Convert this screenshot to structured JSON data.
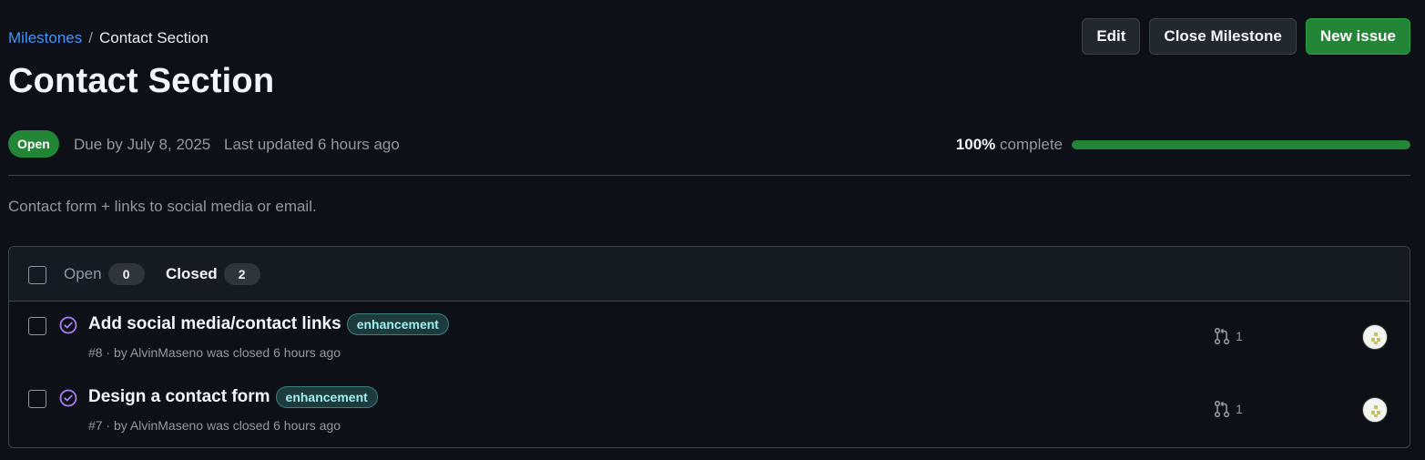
{
  "breadcrumb": {
    "parent_label": "Milestones",
    "separator": "/",
    "current_label": "Contact Section"
  },
  "actions": {
    "edit_label": "Edit",
    "close_label": "Close Milestone",
    "new_issue_label": "New issue"
  },
  "milestone": {
    "title": "Contact Section",
    "state": "Open",
    "due": "Due by July 8, 2025",
    "updated": "Last updated 6 hours ago",
    "progress_percent_label": "100%",
    "progress_suffix": "complete",
    "progress_fraction": 1.0,
    "description": "Contact form + links to social media or email."
  },
  "issues_header": {
    "open_label": "Open",
    "open_count": "0",
    "closed_label": "Closed",
    "closed_count": "2"
  },
  "issues": [
    {
      "title": "Add social media/contact links",
      "label": "enhancement",
      "meta_prefix": "#8 · by ",
      "author": "AlvinMaseno",
      "meta_suffix": " was closed 6 hours ago",
      "linked_prs": "1"
    },
    {
      "title": "Design a contact form",
      "label": "enhancement",
      "meta_prefix": "#7 · by ",
      "author": "AlvinMaseno",
      "meta_suffix": " was closed 6 hours ago",
      "linked_prs": "1"
    }
  ],
  "colors": {
    "background": "#0d1117",
    "accent_green": "#238636",
    "link_blue": "#4493f8",
    "closed_purple": "#ab7df8",
    "label_text": "#a2eeef"
  },
  "icons": {
    "issue_state": "issue-closed-icon",
    "linked_pr": "git-pull-request-icon",
    "assignee": "avatar"
  }
}
